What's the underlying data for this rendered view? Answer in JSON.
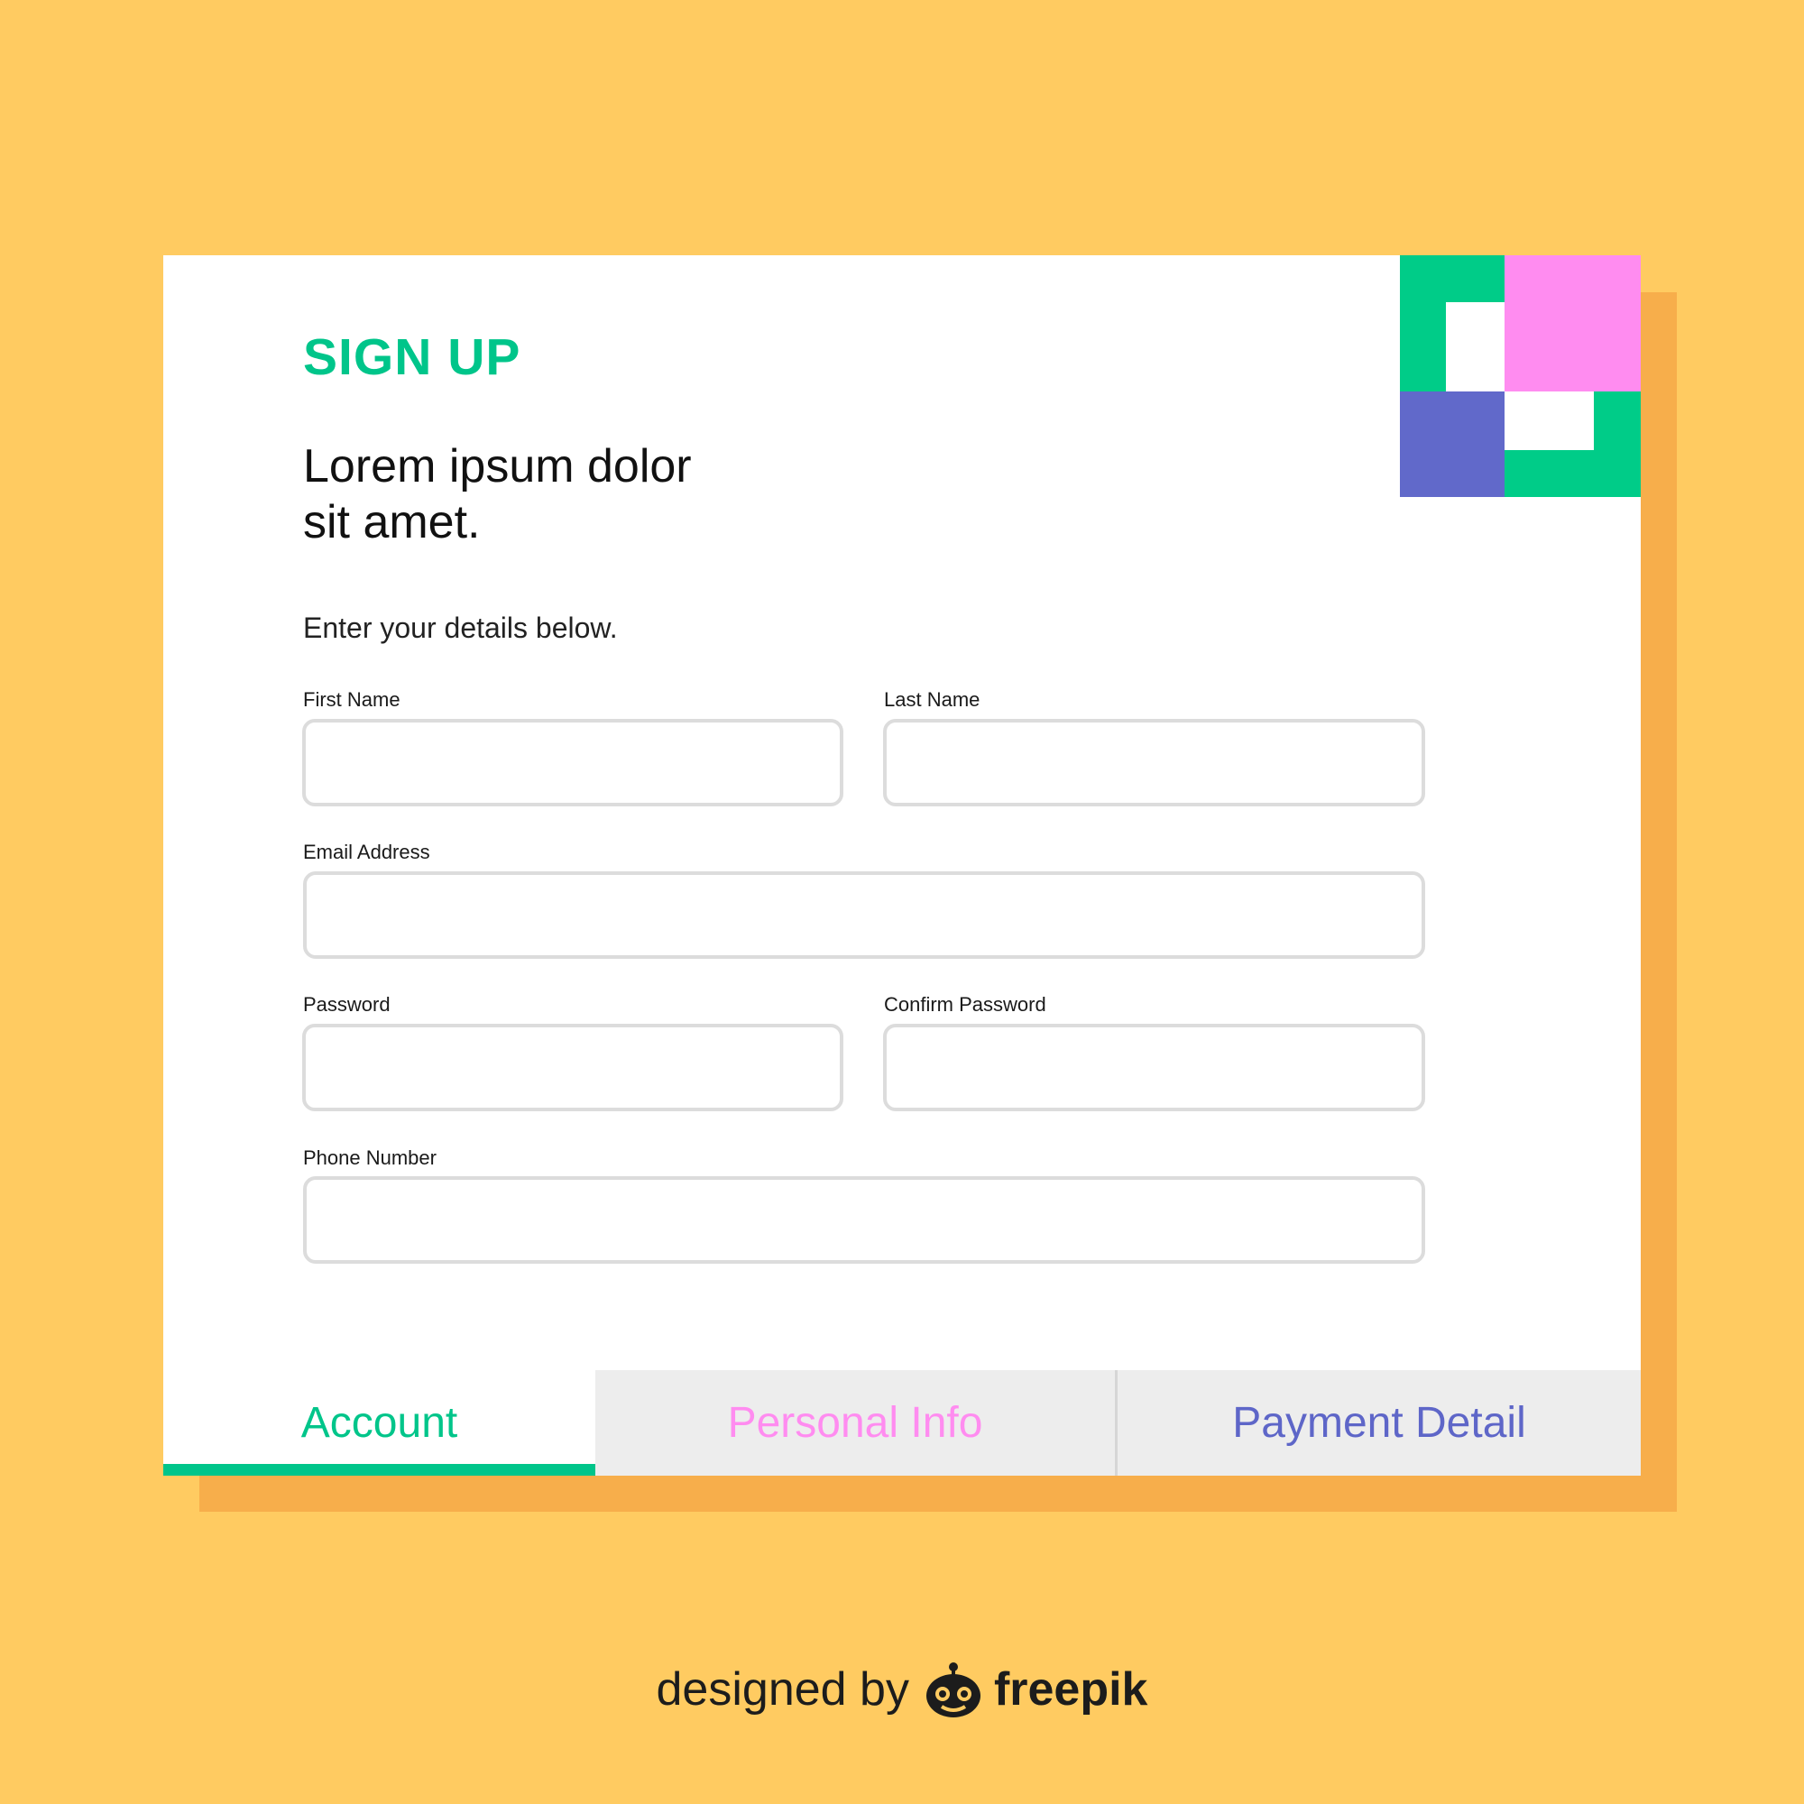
{
  "form": {
    "title": "SIGN UP",
    "heading_line1": "Lorem ipsum dolor",
    "heading_line2": "sit amet.",
    "subtitle": "Enter your details below.",
    "fields": {
      "first_name": {
        "label": "First Name",
        "value": ""
      },
      "last_name": {
        "label": "Last Name",
        "value": ""
      },
      "email": {
        "label": "Email Address",
        "value": ""
      },
      "password": {
        "label": "Password",
        "value": ""
      },
      "confirm_password": {
        "label": "Confirm Password",
        "value": ""
      },
      "phone": {
        "label": "Phone Number",
        "value": ""
      }
    }
  },
  "tabs": [
    {
      "label": "Account",
      "active": true,
      "color": "#00C58A"
    },
    {
      "label": "Personal Info",
      "active": false,
      "color": "#FF8CF0"
    },
    {
      "label": "Payment Detail",
      "active": false,
      "color": "#5E66C8"
    }
  ],
  "colors": {
    "background": "#FFCB61",
    "shadow": "#F7AE4B",
    "accent_green": "#00CC88",
    "accent_pink": "#FF8CF0",
    "accent_purple": "#6169CA"
  },
  "credit": {
    "prefix": "designed by",
    "brand": "freepik",
    "icon": "freepik-logo-icon"
  }
}
